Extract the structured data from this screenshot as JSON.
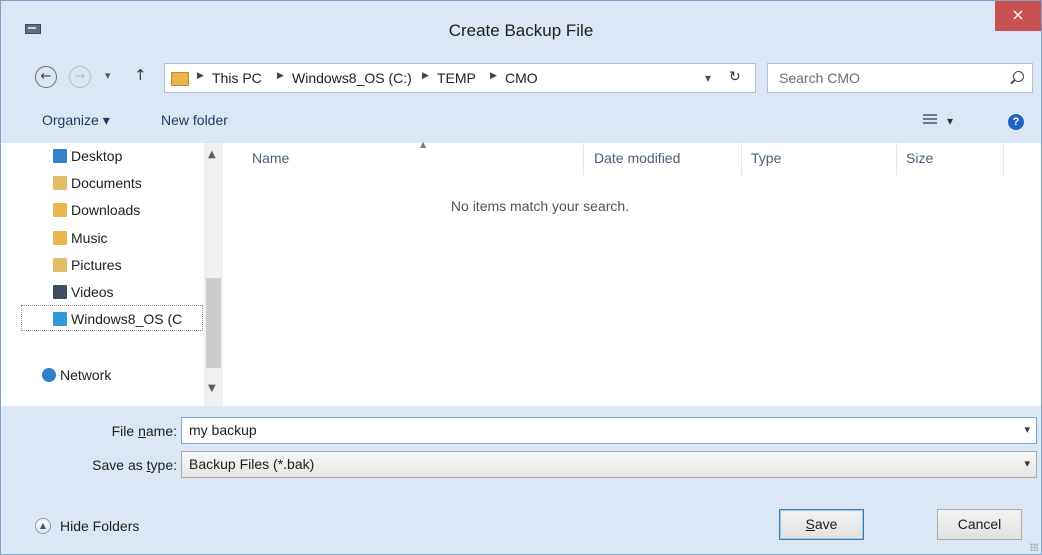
{
  "window": {
    "title": "Create Backup File",
    "close_glyph": "×"
  },
  "nav": {
    "back_glyph": "←",
    "forward_glyph": "→",
    "recent_glyph": "▾",
    "up_glyph": "↑",
    "breadcrumbs": [
      "This PC",
      "Windows8_OS (C:)",
      "TEMP",
      "CMO"
    ],
    "address_dropdown_glyph": "▾",
    "refresh_glyph": "↻",
    "search_placeholder": "Search CMO"
  },
  "toolbar": {
    "organize_label": "Organize ▾",
    "new_folder_label": "New folder",
    "view_dropdown_glyph": "▾",
    "help_glyph": "?"
  },
  "sidebar": {
    "items": [
      {
        "label": "Desktop",
        "icon": "desktop-folder-icon",
        "color": "#3a7fc9"
      },
      {
        "label": "Documents",
        "icon": "documents-folder-icon",
        "color": "#e3bd63"
      },
      {
        "label": "Downloads",
        "icon": "downloads-folder-icon",
        "color": "#e8b64c"
      },
      {
        "label": "Music",
        "icon": "music-folder-icon",
        "color": "#e8b64c"
      },
      {
        "label": "Pictures",
        "icon": "pictures-folder-icon",
        "color": "#e3bd63"
      },
      {
        "label": "Videos",
        "icon": "videos-folder-icon",
        "color": "#3c4e62"
      },
      {
        "label": "Windows8_OS (C",
        "icon": "drive-icon",
        "color": "#2f9ad8"
      },
      {
        "label": "Network",
        "icon": "network-icon",
        "color": "#2f7fc9"
      }
    ],
    "scroll_up_glyph": "▲",
    "scroll_down_glyph": "▼"
  },
  "file_list": {
    "columns": [
      "Name",
      "Date modified",
      "Type",
      "Size"
    ],
    "sort_glyph": "▲",
    "empty_message": "No items match your search."
  },
  "form": {
    "file_name_label_pre": "File ",
    "file_name_label_key": "n",
    "file_name_label_post": "ame:",
    "file_name_value": "my backup",
    "save_type_label_pre": "Save as ",
    "save_type_label_key": "t",
    "save_type_label_post": "ype:",
    "save_type_value": "Backup Files (*.bak)",
    "dropdown_glyph": "▾"
  },
  "footer": {
    "hide_folders_label": "Hide Folders",
    "hide_folders_glyph": "▲",
    "save_label_key": "S",
    "save_label_rest": "ave",
    "cancel_label": "Cancel"
  }
}
